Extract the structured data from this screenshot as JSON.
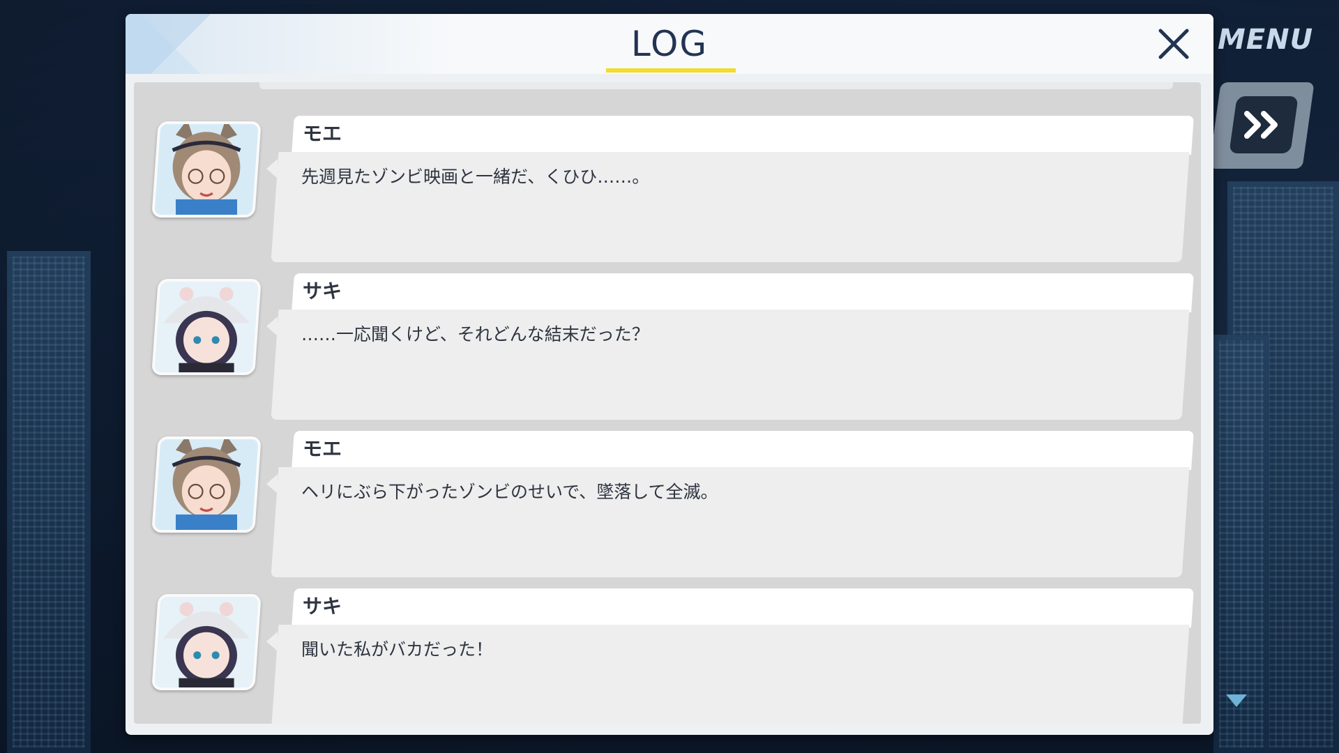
{
  "menu": {
    "label": "MENU"
  },
  "log": {
    "title": "LOG",
    "entries": [
      {
        "speaker": "モエ",
        "text": "先週見たゾンビ映画と一緒だ、くひひ……。",
        "avatar": "moe-portrait"
      },
      {
        "speaker": "サキ",
        "text": "……一応聞くけど、それどんな結末だった？",
        "avatar": "saki-portrait"
      },
      {
        "speaker": "モエ",
        "text": "ヘリにぶら下がったゾンビのせいで、墜落して全滅。",
        "avatar": "moe-portrait"
      },
      {
        "speaker": "サキ",
        "text": "聞いた私がバカだった！",
        "avatar": "saki-portrait"
      }
    ]
  },
  "colors": {
    "title": "#223452",
    "title_underline": "#f2dc2a",
    "scroll_arrow": "#6fb3d6"
  }
}
